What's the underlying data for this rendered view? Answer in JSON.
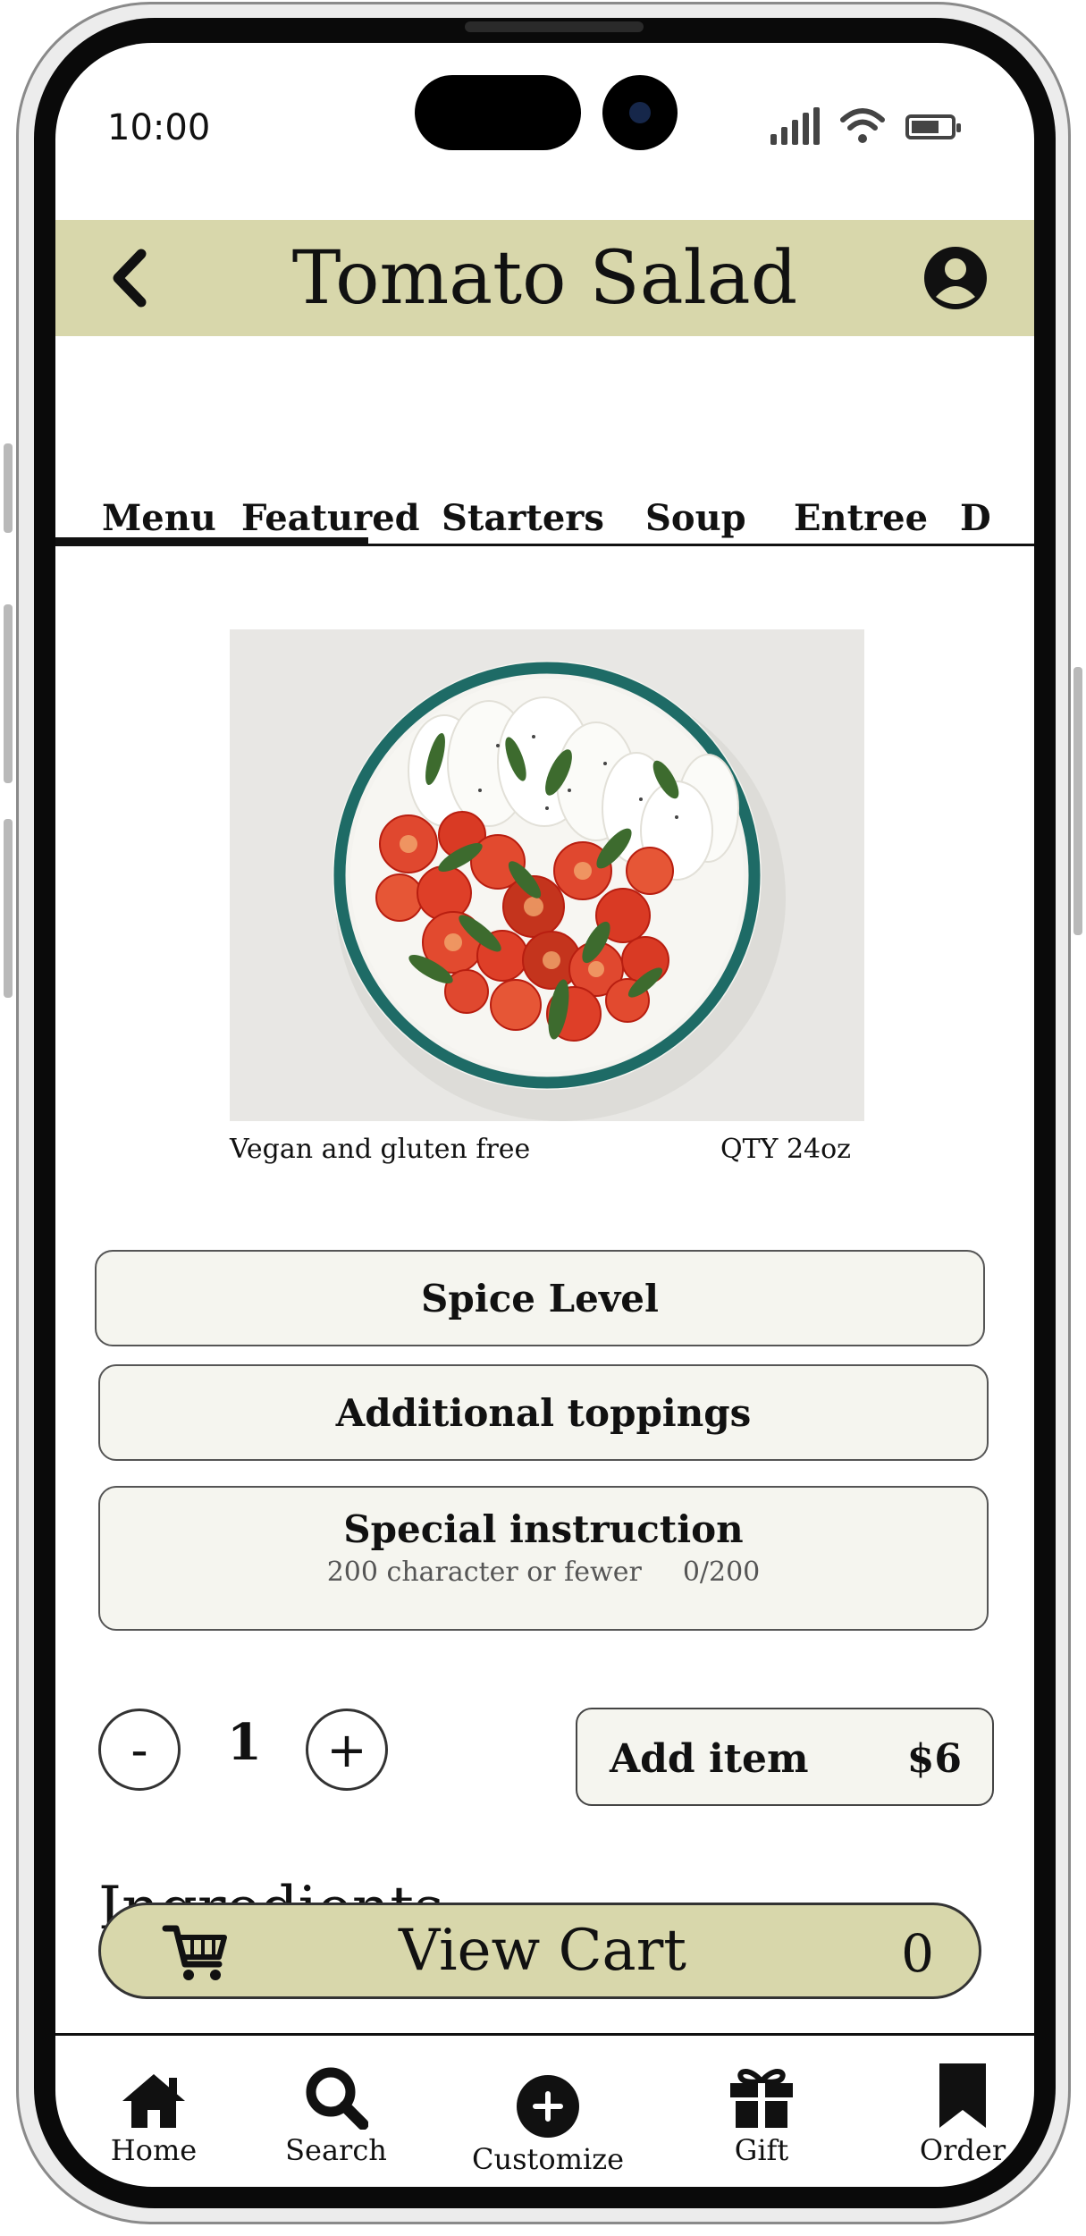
{
  "status_bar": {
    "time": "10:00"
  },
  "header": {
    "title": "Tomato Salad",
    "back_icon": "chevron-left-icon",
    "profile_icon": "user-circle-icon"
  },
  "tabs": [
    "Menu",
    "Featured",
    "Starters",
    "Soup",
    "Entree",
    "D"
  ],
  "active_tab": "Menu",
  "item": {
    "image": "tomato-mozzarella-salad-photo",
    "diet_note": "Vegan and gluten free",
    "quantity_note": "QTY 24oz"
  },
  "options": {
    "spice_level": "Spice Level",
    "additional_toppings": "Additional toppings",
    "special_instruction": {
      "label": "Special instruction",
      "hint": "200 character or fewer",
      "counter": "0/200"
    }
  },
  "quantity": {
    "minus_label": "-",
    "plus_label": "+",
    "value": "1"
  },
  "add_item": {
    "label": "Add item",
    "price": "$6"
  },
  "ingredients_heading": "Ingredients",
  "view_cart": {
    "label": "View Cart",
    "count": "0",
    "icon": "cart-icon"
  },
  "bottom_nav": [
    {
      "label": "Home",
      "icon": "home-icon"
    },
    {
      "label": "Search",
      "icon": "search-icon"
    },
    {
      "label": "Customize",
      "icon": "plus-circle-icon"
    },
    {
      "label": "Gift",
      "icon": "gift-icon"
    },
    {
      "label": "Order",
      "icon": "bookmark-icon"
    }
  ],
  "colors": {
    "accent": "#d8d7ab",
    "card": "#f5f5ef",
    "plate_rim": "#1e6b66"
  }
}
